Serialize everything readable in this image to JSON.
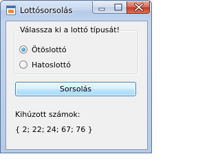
{
  "window": {
    "title": "Lottósorsolás"
  },
  "group": {
    "legend": "Válassza ki a lottó típusát!",
    "options": [
      {
        "label": "Ötöslottó",
        "selected": true
      },
      {
        "label": "Hatoslottó",
        "selected": false
      }
    ]
  },
  "draw_button": {
    "label": "Sorsolás"
  },
  "result": {
    "label": "Kihúzott számok:",
    "value": "{ 2; 22; 24; 67; 76 }"
  },
  "icons": {
    "app": "app-window-icon",
    "minimize": "minimize-icon",
    "maximize": "maximize-icon",
    "close": "close-icon"
  },
  "colors": {
    "title_bar": "#c4d6ee",
    "close_button": "#c43c22",
    "radio_selected": "#1e6fb1",
    "button_border": "#3c7fb1",
    "client_background": "#f0f0f0"
  }
}
